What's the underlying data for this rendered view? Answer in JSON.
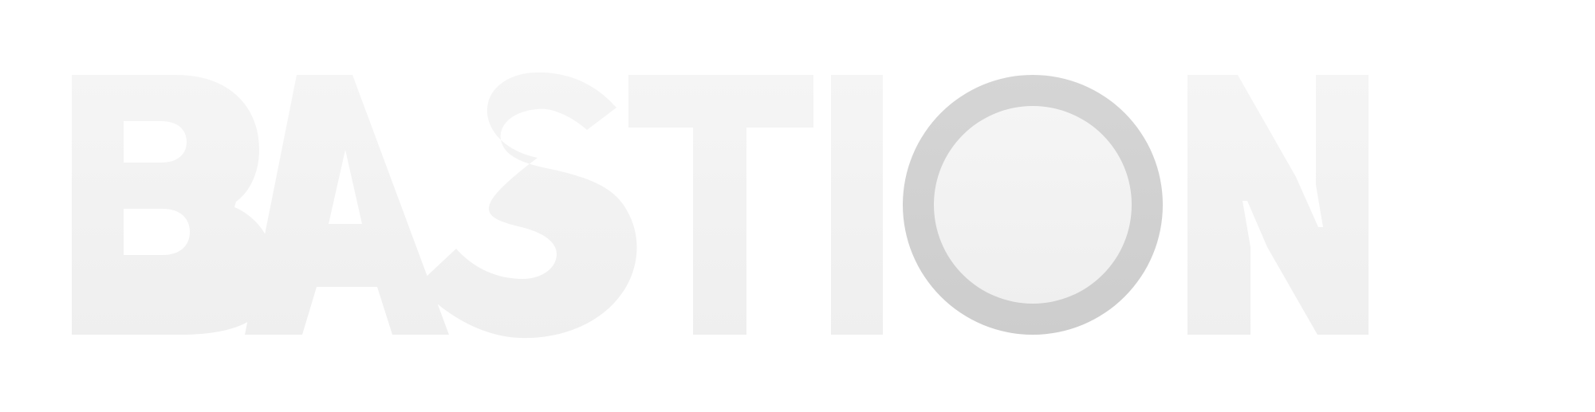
{
  "logo": {
    "wordmark": "BASTION",
    "colors": {
      "letter_fill_top": "#f5f5f5",
      "letter_fill_bottom": "#efefef",
      "ring_fill_top": "#d5d5d5",
      "ring_fill_bottom": "#cdcdcd",
      "background": "#ffffff"
    }
  }
}
